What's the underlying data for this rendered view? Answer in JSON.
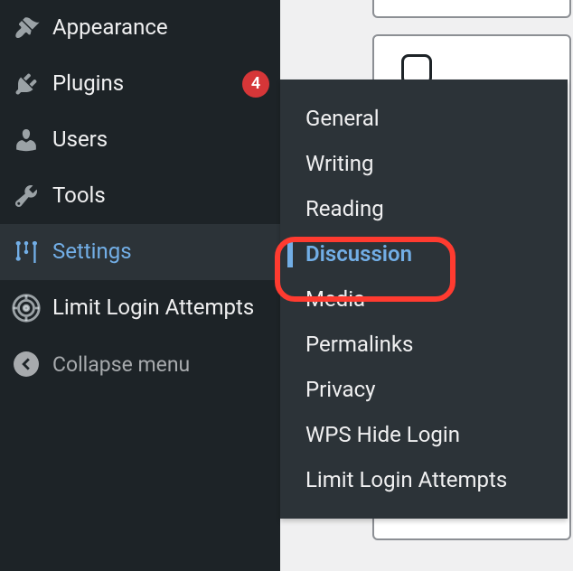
{
  "sidebar": {
    "items": [
      {
        "label": "Appearance"
      },
      {
        "label": "Plugins",
        "badge": "4"
      },
      {
        "label": "Users"
      },
      {
        "label": "Tools"
      },
      {
        "label": "Settings"
      },
      {
        "label": "Limit Login Attempts"
      }
    ],
    "collapse_label": "Collapse menu"
  },
  "submenu": {
    "items": [
      {
        "label": "General"
      },
      {
        "label": "Writing"
      },
      {
        "label": "Reading"
      },
      {
        "label": "Discussion",
        "active": true
      },
      {
        "label": "Media"
      },
      {
        "label": "Permalinks"
      },
      {
        "label": "Privacy"
      },
      {
        "label": "WPS Hide Login"
      },
      {
        "label": "Limit Login Attempts"
      }
    ]
  }
}
